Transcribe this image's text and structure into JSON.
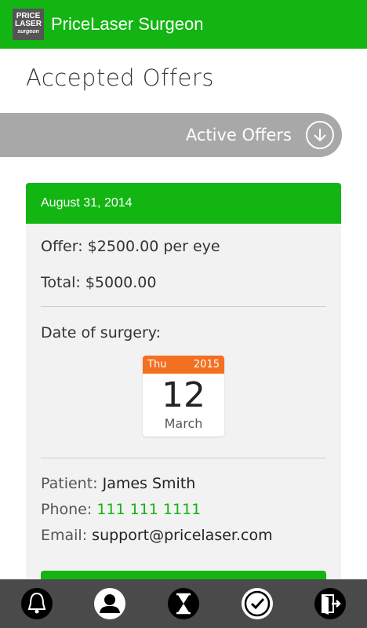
{
  "app": {
    "logo_line1": "PRICE",
    "logo_line2": "LASER",
    "logo_line3": "surgeon",
    "title": "PriceLaser Surgeon"
  },
  "page": {
    "title": "Accepted Offers",
    "active_offers_label": "Active Offers"
  },
  "offer": {
    "date": "August 31, 2014",
    "offer_text": "Offer: $2500.00 per eye",
    "total_text": "Total: $5000.00",
    "surgery_label": "Date of surgery:",
    "calendar": {
      "weekday": "Thu",
      "year": "2015",
      "day": "12",
      "month": "March"
    },
    "patient_label": "Patient:",
    "patient_name": "James Smith",
    "phone_label": "Phone:",
    "phone": "111 111 1111",
    "email_label": "Email:",
    "email": "support@pricelaser.com"
  },
  "bottom_nav": [
    {
      "icon": "bell-icon"
    },
    {
      "icon": "user-icon"
    },
    {
      "icon": "hourglass-icon"
    },
    {
      "icon": "check-circle-icon"
    },
    {
      "icon": "logout-icon"
    }
  ],
  "colors": {
    "brand_green": "#12b512",
    "calendar_orange": "#f37021",
    "gray_bar": "#a8a8a8",
    "bottom_bar": "#4a4a4a"
  }
}
